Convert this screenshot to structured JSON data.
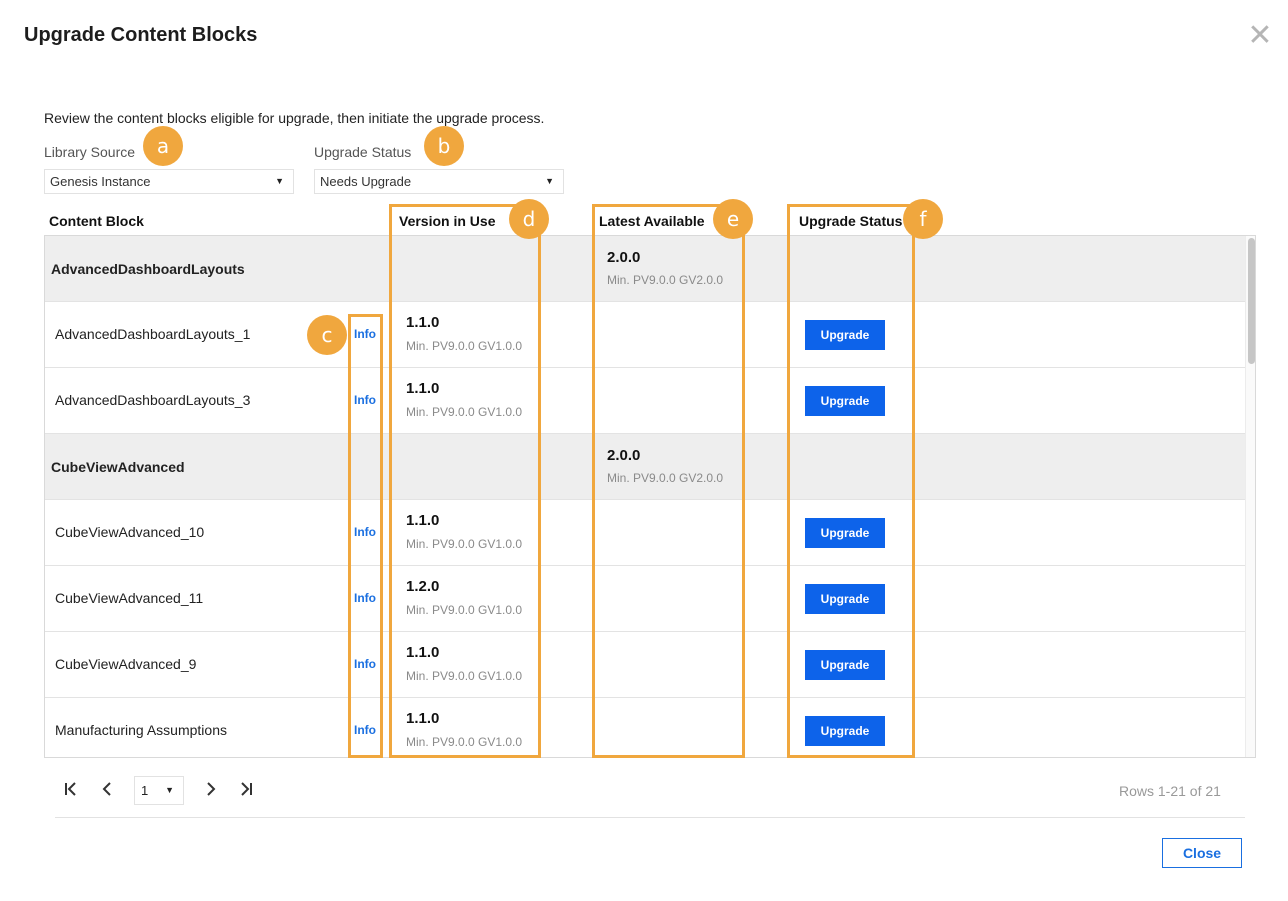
{
  "dialog": {
    "title": "Upgrade Content Blocks",
    "close_icon": "close-icon",
    "description": "Review the content blocks eligible for upgrade, then initiate the upgrade process."
  },
  "filters": {
    "library_source": {
      "label": "Library Source",
      "value": "Genesis Instance"
    },
    "upgrade_status": {
      "label": "Upgrade Status",
      "value": "Needs Upgrade"
    }
  },
  "badges": [
    "a",
    "b",
    "c",
    "d",
    "e",
    "f"
  ],
  "columns": {
    "content_block": "Content Block",
    "version_in_use": "Version in Use",
    "latest_available": "Latest Available",
    "upgrade_status": "Upgrade Status"
  },
  "rows": [
    {
      "type": "group",
      "name": "AdvancedDashboardLayouts",
      "latest": "2.0.0",
      "latest_min": "Min. PV9.0.0 GV2.0.0"
    },
    {
      "type": "item",
      "name": "AdvancedDashboardLayouts_1",
      "info": "Info",
      "version": "1.1.0",
      "version_min": "Min. PV9.0.0 GV1.0.0",
      "action": "Upgrade"
    },
    {
      "type": "item",
      "name": "AdvancedDashboardLayouts_3",
      "info": "Info",
      "version": "1.1.0",
      "version_min": "Min. PV9.0.0 GV1.0.0",
      "action": "Upgrade"
    },
    {
      "type": "group",
      "name": "CubeViewAdvanced",
      "latest": "2.0.0",
      "latest_min": "Min. PV9.0.0 GV2.0.0"
    },
    {
      "type": "item",
      "name": "CubeViewAdvanced_10",
      "info": "Info",
      "version": "1.1.0",
      "version_min": "Min. PV9.0.0 GV1.0.0",
      "action": "Upgrade"
    },
    {
      "type": "item",
      "name": "CubeViewAdvanced_11",
      "info": "Info",
      "version": "1.2.0",
      "version_min": "Min. PV9.0.0 GV1.0.0",
      "action": "Upgrade"
    },
    {
      "type": "item",
      "name": "CubeViewAdvanced_9",
      "info": "Info",
      "version": "1.1.0",
      "version_min": "Min. PV9.0.0 GV1.0.0",
      "action": "Upgrade"
    },
    {
      "type": "item",
      "name": "Manufacturing Assumptions",
      "info": "Info",
      "version": "1.1.0",
      "version_min": "Min. PV9.0.0 GV1.0.0",
      "action": "Upgrade"
    }
  ],
  "pagination": {
    "first_icon": "first-page-icon",
    "prev_icon": "prev-page-icon",
    "next_icon": "next-page-icon",
    "last_icon": "last-page-icon",
    "page": "1",
    "rows_info": "Rows 1-21 of 21"
  },
  "footer": {
    "close_label": "Close"
  },
  "colors": {
    "accent": "#0d63ea",
    "highlight": "#f0a73e",
    "group_bg": "#eeeeee"
  }
}
